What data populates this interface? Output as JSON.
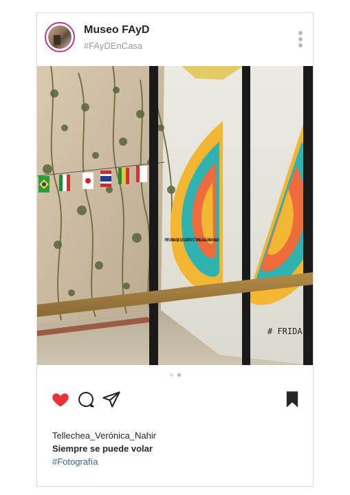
{
  "post": {
    "username": "Museo FAyD",
    "subtitle": "#FAyDEnCasa",
    "photo": {
      "mural_text": "PIES PARA QUE LOS QUIERO SI TENGO ALAS PARA VOLAR",
      "signature": "# FRIDA"
    },
    "carousel": {
      "total": 2,
      "active": 2
    },
    "author": "Tellechea_Verónica_Nahir",
    "caption": "Siempre se puede volar",
    "hashtag": "#Fotografía"
  },
  "icons": {
    "like": "heart-icon",
    "comment": "comment-icon",
    "share": "paper-plane-icon",
    "save": "bookmark-icon",
    "more": "more-vertical-icon"
  },
  "colors": {
    "like": "#e8333b",
    "avatar_ring": "#c2358e",
    "hashtag": "#3b5f9e",
    "text": "#262626",
    "muted": "#9a9a9a"
  }
}
